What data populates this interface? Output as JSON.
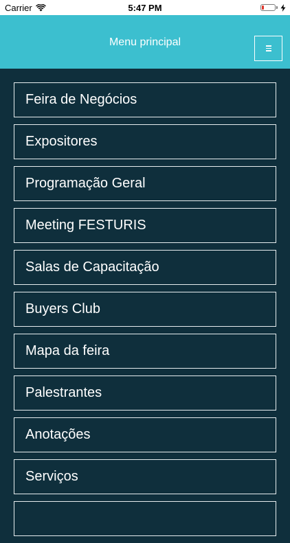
{
  "status_bar": {
    "carrier": "Carrier",
    "time": "5:47 PM",
    "battery_level": 0.15,
    "icons": [
      "wifi-icon",
      "battery-icon",
      "charging-icon"
    ]
  },
  "header": {
    "title": "Menu principal",
    "menu_icon": "hamburger-icon",
    "background": "#3cbfcf"
  },
  "menu": {
    "items": [
      {
        "label": "Feira de Negócios"
      },
      {
        "label": "Expositores"
      },
      {
        "label": "Programação Geral"
      },
      {
        "label": "Meeting FESTURIS"
      },
      {
        "label": "Salas de Capacitação"
      },
      {
        "label": "Buyers Club"
      },
      {
        "label": "Mapa da feira"
      },
      {
        "label": "Palestrantes"
      },
      {
        "label": "Anotações"
      },
      {
        "label": "Serviços"
      },
      {
        "label": ""
      }
    ]
  },
  "colors": {
    "background": "#0f2f3c",
    "border": "#e8eef0",
    "text": "#ffffff"
  }
}
